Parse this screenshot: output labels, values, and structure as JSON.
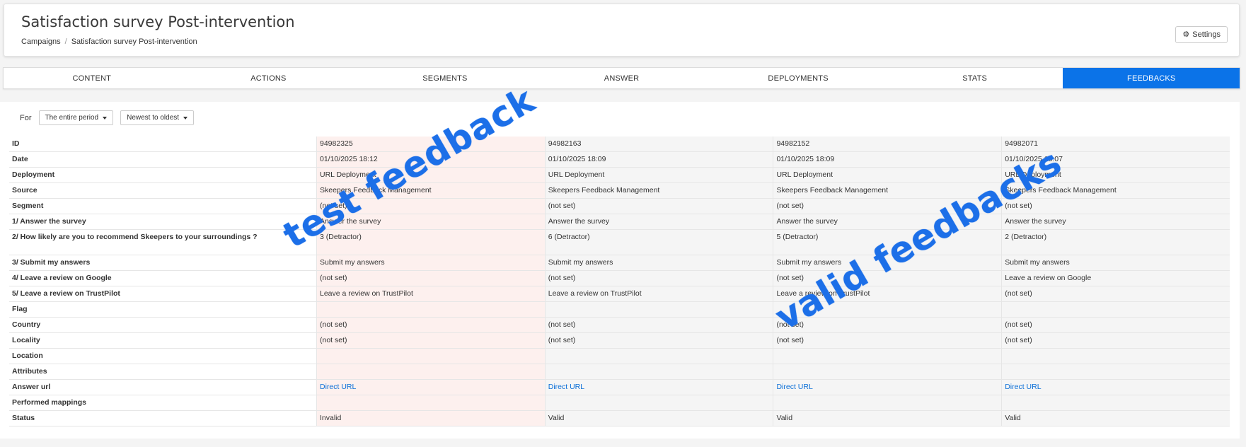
{
  "header": {
    "title": "Satisfaction survey Post-intervention",
    "breadcrumb": [
      "Campaigns",
      "Satisfaction survey Post-intervention"
    ],
    "settings_label": "Settings"
  },
  "tabs": [
    {
      "label": "CONTENT",
      "active": false
    },
    {
      "label": "ACTIONS",
      "active": false
    },
    {
      "label": "SEGMENTS",
      "active": false
    },
    {
      "label": "ANSWER",
      "active": false
    },
    {
      "label": "DEPLOYMENTS",
      "active": false
    },
    {
      "label": "STATS",
      "active": false
    },
    {
      "label": "FEEDBACKS",
      "active": true
    }
  ],
  "filters": {
    "for_label": "For",
    "period": "The entire period",
    "order": "Newest to oldest"
  },
  "rows": [
    "ID",
    "Date",
    "Deployment",
    "Source",
    "Segment",
    "1/ Answer the survey",
    "2/ How likely are you to recommend Skeepers to your surroundings ?",
    "3/ Submit my answers",
    "4/ Leave a review on Google",
    "5/ Leave a review on TrustPilot",
    "Flag",
    "Country",
    "Locality",
    "Location",
    "Attributes",
    "Answer url",
    "Performed mappings",
    "Status"
  ],
  "feedbacks": [
    [
      "94982325",
      "01/10/2025 18:12",
      "URL Deployment",
      "Skeepers Feedback Management",
      "(not set)",
      "Answer the survey",
      "3 (Detractor)",
      "Submit my answers",
      "(not set)",
      "Leave a review on TrustPilot",
      "",
      "(not set)",
      "(not set)",
      "",
      "",
      "Direct URL",
      "",
      "Invalid"
    ],
    [
      "94982163",
      "01/10/2025 18:09",
      "URL Deployment",
      "Skeepers Feedback Management",
      "(not set)",
      "Answer the survey",
      "6 (Detractor)",
      "Submit my answers",
      "(not set)",
      "Leave a review on TrustPilot",
      "",
      "(not set)",
      "(not set)",
      "",
      "",
      "Direct URL",
      "",
      "Valid"
    ],
    [
      "94982152",
      "01/10/2025 18:09",
      "URL Deployment",
      "Skeepers Feedback Management",
      "(not set)",
      "Answer the survey",
      "5 (Detractor)",
      "Submit my answers",
      "(not set)",
      "Leave a review on TrustPilot",
      "",
      "(not set)",
      "(not set)",
      "",
      "",
      "Direct URL",
      "",
      "Valid"
    ],
    [
      "94982071",
      "01/10/2025 18:07",
      "URL Deployment",
      "Skeepers Feedback Management",
      "(not set)",
      "Answer the survey",
      "2 (Detractor)",
      "Submit my answers",
      "Leave a review on Google",
      "(not set)",
      "",
      "(not set)",
      "(not set)",
      "",
      "",
      "Direct URL",
      "",
      "Valid"
    ]
  ],
  "annotations": {
    "test": "test feedback",
    "valid": "valid feedbacks"
  },
  "colors": {
    "accent": "#0b73e8",
    "link": "#0b6fd8",
    "test_column_bg": "#fdf0ee",
    "column_bg": "#f5f5f5",
    "annotation": "#1c6fe8"
  }
}
